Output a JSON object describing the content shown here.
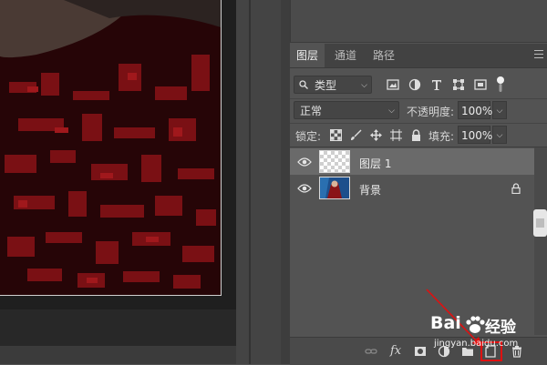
{
  "panel": {
    "tabs": [
      {
        "label": "图层",
        "active": true
      },
      {
        "label": "通道",
        "active": false
      },
      {
        "label": "路径",
        "active": false
      }
    ],
    "filter": {
      "selected": "类型"
    },
    "blend_mode": "正常",
    "opacity": {
      "label": "不透明度:",
      "value": "100%"
    },
    "lock": {
      "label": "锁定:"
    },
    "fill": {
      "label": "填充:",
      "value": "100%"
    },
    "layers": [
      {
        "name": "图层 1",
        "visible": true,
        "selected": true,
        "thumbnail": "transparent-checkerboard",
        "locked": false
      },
      {
        "name": "背景",
        "visible": true,
        "selected": false,
        "thumbnail": "photo",
        "locked": true
      }
    ],
    "footer_icons": [
      "link-layers-icon",
      "fx-icon",
      "add-mask-icon",
      "adjustment-layer-icon",
      "group-folder-icon",
      "new-layer-icon",
      "trash-icon"
    ],
    "fx_label": "fx"
  },
  "watermark": {
    "brand_left": "Bai",
    "brand_right": "经验",
    "url": "jingyan.baidu.com"
  },
  "colors": {
    "panel_bg": "#535353",
    "selected_layer_bg": "#6a6a6a",
    "annotation_red": "#e01010"
  }
}
